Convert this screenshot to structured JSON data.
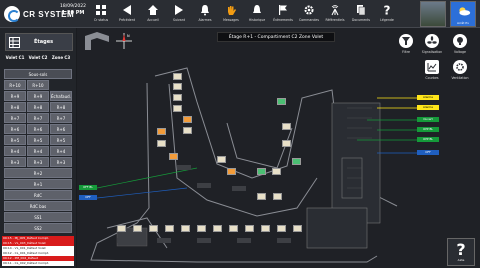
{
  "app": {
    "brand": "CR SYSTEM",
    "date": "18/09/2022",
    "time": "1:20 PM"
  },
  "nav": [
    {
      "label": "Cr status",
      "icon": "grid-icon"
    },
    {
      "label": "Précédent",
      "icon": "back-icon"
    },
    {
      "label": "Accueil",
      "icon": "home-icon"
    },
    {
      "label": "Suivant",
      "icon": "forward-icon"
    },
    {
      "label": "Alarmes",
      "icon": "alarm-bell-icon"
    },
    {
      "label": "Messages",
      "icon": "hand-icon"
    },
    {
      "label": "Historique",
      "icon": "bell-icon"
    },
    {
      "label": "Évènements",
      "icon": "flag-icon"
    },
    {
      "label": "Commandes",
      "icon": "gear-icon"
    },
    {
      "label": "Référentiels",
      "icon": "antenna-icon"
    },
    {
      "label": "Documents",
      "icon": "document-icon"
    },
    {
      "label": "Légende",
      "icon": "help-icon"
    }
  ],
  "thumbs": [
    {
      "label": ""
    },
    {
      "label": "Arrêt Pv"
    }
  ],
  "left_panel": {
    "stage_title": "Étages",
    "col_headers": [
      "Volet C1",
      "Volet C2",
      "Zone C3"
    ],
    "rows": [
      [
        "",
        "Sous-sols",
        ""
      ],
      [
        "R+10",
        "R+10",
        ""
      ],
      [
        "R+9",
        "R+9",
        "Échafaud."
      ],
      [
        "R+8",
        "R+8",
        "R+8"
      ],
      [
        "R+7",
        "R+7",
        "R+7"
      ],
      [
        "R+6",
        "R+6",
        "R+6"
      ],
      [
        "R+5",
        "R+5",
        "R+5"
      ],
      [
        "R+4",
        "R+4",
        "R+4"
      ],
      [
        "R+3",
        "R+3",
        "R+3"
      ]
    ],
    "wide_rows": [
      "R+2",
      "R+1",
      "RdC",
      "RdC bas",
      "SS1",
      "SS2"
    ],
    "alarms": [
      {
        "text": "09:15 - MJ_005_Défaut Compt.",
        "level": "red"
      },
      {
        "text": "09:15 - VL_003_Défaut Volet",
        "level": "red"
      },
      {
        "text": "09:14 - VL_001_Défaut Volet",
        "level": "white"
      },
      {
        "text": "09:12 - CL_001_Défaut Compt.",
        "level": "white"
      },
      {
        "text": "09:12 - PM_002_Défaut",
        "level": "red"
      },
      {
        "text": "09:11 - CL_002_Défaut Compt.",
        "level": "white"
      }
    ]
  },
  "main": {
    "title": "Étage R+1 - Compartiment C2 Zone Volet",
    "controls": [
      {
        "label": "Filtre",
        "icon": "filter-icon"
      },
      {
        "label": "Signalisation",
        "icon": "fan-icon"
      },
      {
        "label": "Voltage",
        "icon": "bulb-icon"
      },
      {
        "label": "Courbes",
        "icon": "chart-icon"
      },
      {
        "label": "Ventilation",
        "icon": "settings-icon"
      }
    ],
    "help_label": "Aide",
    "status_tags": [
      {
        "text": "Alarme",
        "color": "yellow"
      },
      {
        "text": "Alarme",
        "color": "yellow"
      },
      {
        "text": "Ouvert",
        "color": "green"
      },
      {
        "text": "OPP BL",
        "color": "green"
      },
      {
        "text": "OPP BL",
        "color": "green"
      },
      {
        "text": "OFF",
        "color": "blue"
      }
    ],
    "left_tags": [
      {
        "text": "OFF BL",
        "color": "green"
      },
      {
        "text": "OFF",
        "color": "blue"
      }
    ]
  }
}
